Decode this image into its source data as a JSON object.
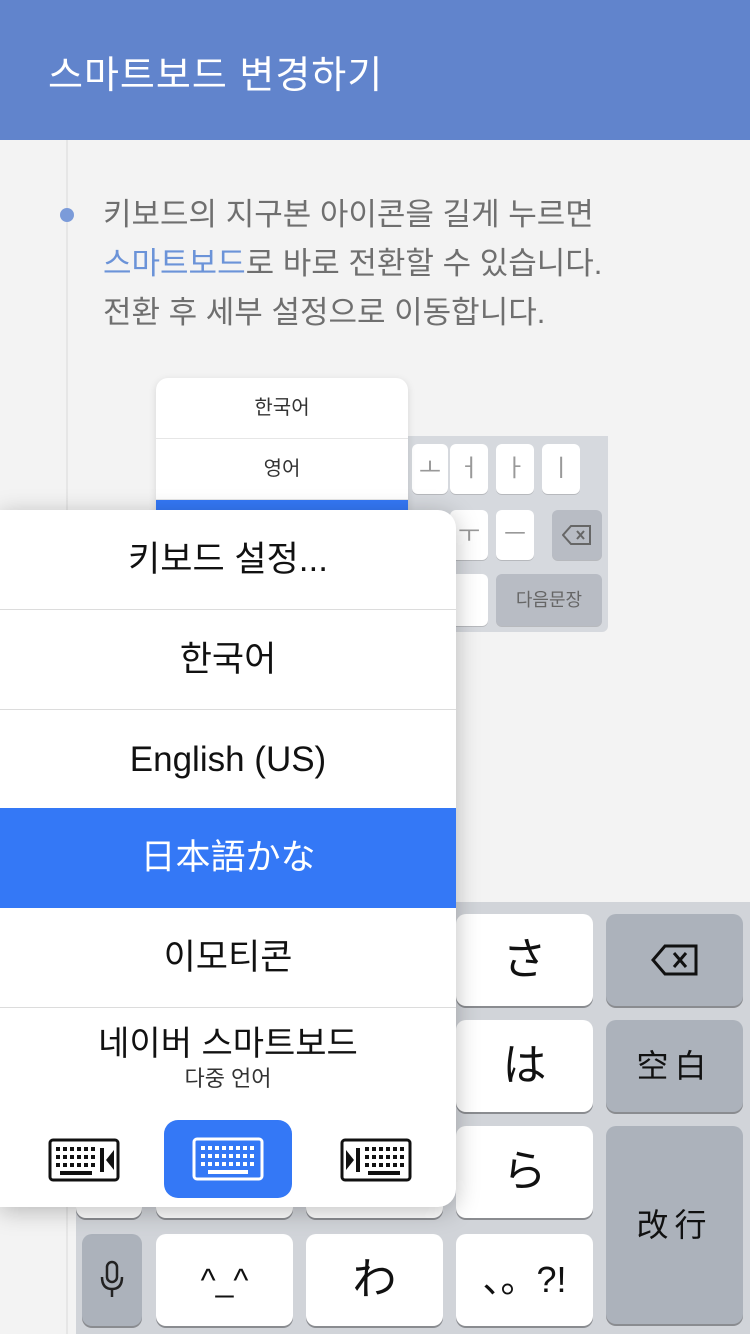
{
  "header": {
    "title": "스마트보드 변경하기"
  },
  "guide": {
    "line1": "키보드의 지구본 아이콘을 길게 누르면",
    "highlight": "스마트보드",
    "line2_rest": "로 바로 전환할 수 있습니다.",
    "line3": "전환 후 세부 설정으로 이동합니다."
  },
  "illustration": {
    "popup_items": [
      "한국어",
      "영어"
    ],
    "key_labels": [
      "ㅗ",
      "ㅓ",
      "ㅏ",
      "ㅣ",
      "ㅜ",
      "ㅡ"
    ],
    "next_sentence": "다음문장"
  },
  "menu": {
    "settings": "키보드 설정...",
    "korean": "한국어",
    "english": "English (US)",
    "japanese": "日本語かな",
    "emoticon": "이모티콘",
    "smartboard": "네이버 스마트보드",
    "smartboard_sub": "다중 언어"
  },
  "keyboard": {
    "sa": "さ",
    "ha": "は",
    "ra": "ら",
    "space": "空白",
    "enter": "改行",
    "kaomoji": "^_^",
    "wa": "わ",
    "punct": "、。?!"
  },
  "colors": {
    "header": "#6184cc",
    "accent": "#3478f6",
    "highlight": "#6b93d8"
  }
}
